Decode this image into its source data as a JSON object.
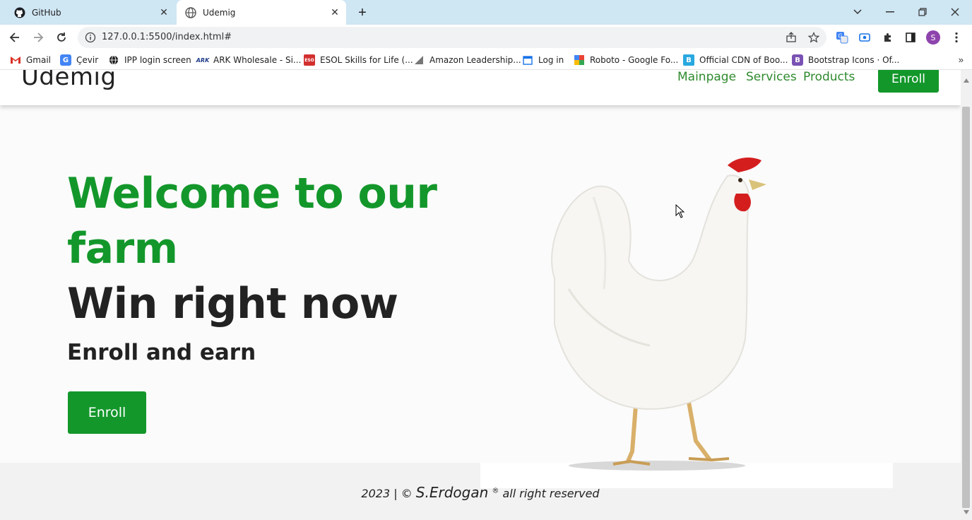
{
  "browser": {
    "tabs": [
      {
        "title": "GitHub",
        "active": false,
        "icon": "github-icon"
      },
      {
        "title": "Udemig",
        "active": true,
        "icon": "globe-icon"
      }
    ],
    "url": "127.0.0.1:5500/index.html#",
    "bookmarks": [
      {
        "label": "Gmail",
        "icon": "gmail-icon",
        "color": "#d93025"
      },
      {
        "label": "Çevir",
        "icon": "translate-icon",
        "color": "#4285f4"
      },
      {
        "label": "IPP login screen",
        "icon": "globe-icon",
        "color": "#222222"
      },
      {
        "label": "ARK Wholesale - Si...",
        "icon": "ark-icon",
        "color": "#1f3b8a"
      },
      {
        "label": "ESOL Skills for Life (...",
        "icon": "esol-icon",
        "color": "#d32f2f"
      },
      {
        "label": "Amazon Leadership...",
        "icon": "chart-icon",
        "color": "#555555"
      },
      {
        "label": "Log in",
        "icon": "calendar-icon",
        "color": "#1a73e8"
      },
      {
        "label": "Roboto - Google Fo...",
        "icon": "google-fonts-icon",
        "color": "#fbbc04"
      },
      {
        "label": "Official CDN of Boo...",
        "icon": "bootstrap-cdn-icon",
        "color": "#29a8e0"
      },
      {
        "label": "Bootstrap Icons · Of...",
        "icon": "bootstrap-icon",
        "color": "#7952b3"
      }
    ],
    "more": "»",
    "profile_initial": "S"
  },
  "site": {
    "logo": "Udemig",
    "nav": [
      "Mainpage",
      "Services",
      "Products"
    ],
    "enroll_top": "Enroll",
    "hero": {
      "title": "Welcome to our farm",
      "subtitle": "Win right now",
      "tagline": "Enroll and earn",
      "button": "Enroll"
    },
    "footer": {
      "year": "2023 | ©",
      "name": "S.Erdogan",
      "reg": "®",
      "rest": "all right reserved"
    }
  },
  "colors": {
    "brand_green": "#13972b",
    "nav_green": "#2f8a2f",
    "text_dark": "#222222"
  }
}
